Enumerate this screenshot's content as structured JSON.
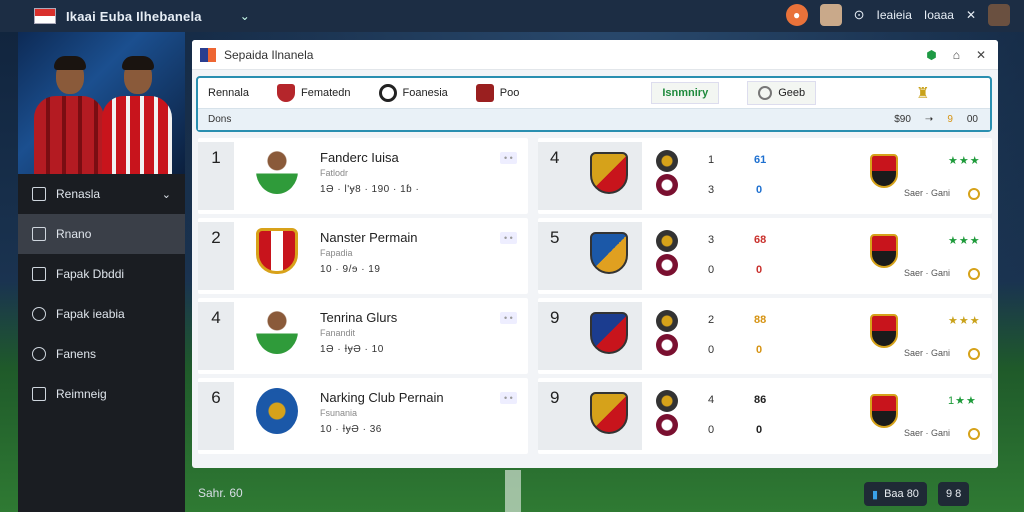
{
  "app": {
    "title": "Ikaai Euba Ilhebanela"
  },
  "topbar": {
    "right_labels": [
      "Ieaieia",
      "Ioaaa"
    ]
  },
  "sidebar": {
    "items": [
      {
        "label": "Renasla",
        "icon": "grid-icon",
        "active": false,
        "dropdown": true
      },
      {
        "label": "Rnano",
        "icon": "board-icon",
        "active": true
      },
      {
        "label": "Fapak Dbddi",
        "icon": "chart-icon",
        "active": false
      },
      {
        "label": "Fapak ieabia",
        "icon": "shield-icon",
        "active": false
      },
      {
        "label": "Fanens",
        "icon": "users-icon",
        "active": false
      },
      {
        "label": "Reimneig",
        "icon": "settings-icon",
        "active": false
      }
    ]
  },
  "window": {
    "title": "Sepaida Ilnanela"
  },
  "tabs": [
    {
      "label": "Rennala"
    },
    {
      "label": "Fematedn"
    },
    {
      "label": "Foanesia"
    },
    {
      "label": "Poo"
    },
    {
      "label": "Isnmniry"
    },
    {
      "label": "Geeb"
    }
  ],
  "subbar": {
    "left": "Dons",
    "right": [
      "$90",
      "9",
      "00"
    ]
  },
  "leaders": [
    {
      "rank": "1",
      "name": "Fanderc Iuisa",
      "sub": "Fatlodr",
      "stats": "1Ə · Ɩ'ɏ8 · 190 · 1ɓ ·",
      "crest": "player"
    },
    {
      "rank": "2",
      "name": "Nanster Permain",
      "sub": "Fapadia",
      "stats": "10 · 9/ɘ · 19",
      "crest": "club-red"
    },
    {
      "rank": "4",
      "name": "Tenrina Glurs",
      "sub": "Fanandit",
      "stats": "1Ə · ƗɏƏ · 10",
      "crest": "player"
    },
    {
      "rank": "6",
      "name": "Narking Club Pernain",
      "sub": "Fsunania",
      "stats": "10 · ƗɏƏ · 36",
      "crest": "club-blue"
    }
  ],
  "matches": [
    {
      "rank": "4",
      "home": "1",
      "away": "3",
      "score_top": "61",
      "score_bot": "0",
      "stars": "★★★",
      "foot": "Saer · Gani",
      "score_color": "#1e70d0",
      "star_color": "#1d9a3a"
    },
    {
      "rank": "5",
      "home": "3",
      "away": "0",
      "score_top": "68",
      "score_bot": "0",
      "stars": "★★★",
      "foot": "Saer · Gani",
      "score_color": "#c9302c",
      "star_color": "#1d9a3a"
    },
    {
      "rank": "9",
      "home": "2",
      "away": "0",
      "score_top": "88",
      "score_bot": "0",
      "stars": "★★★",
      "foot": "Saer · Gani",
      "score_color": "#d69312",
      "star_color": "#c9a21a"
    },
    {
      "rank": "9",
      "home": "4",
      "away": "0",
      "score_top": "86",
      "score_bot": "0",
      "stars": "1★★",
      "foot": "Saer · Gani",
      "score_color": "#222",
      "star_color": "#1d9a3a"
    }
  ],
  "footer": {
    "left": "Sahr. 60",
    "pill1": "Baa 80",
    "pill2": "9 8"
  }
}
